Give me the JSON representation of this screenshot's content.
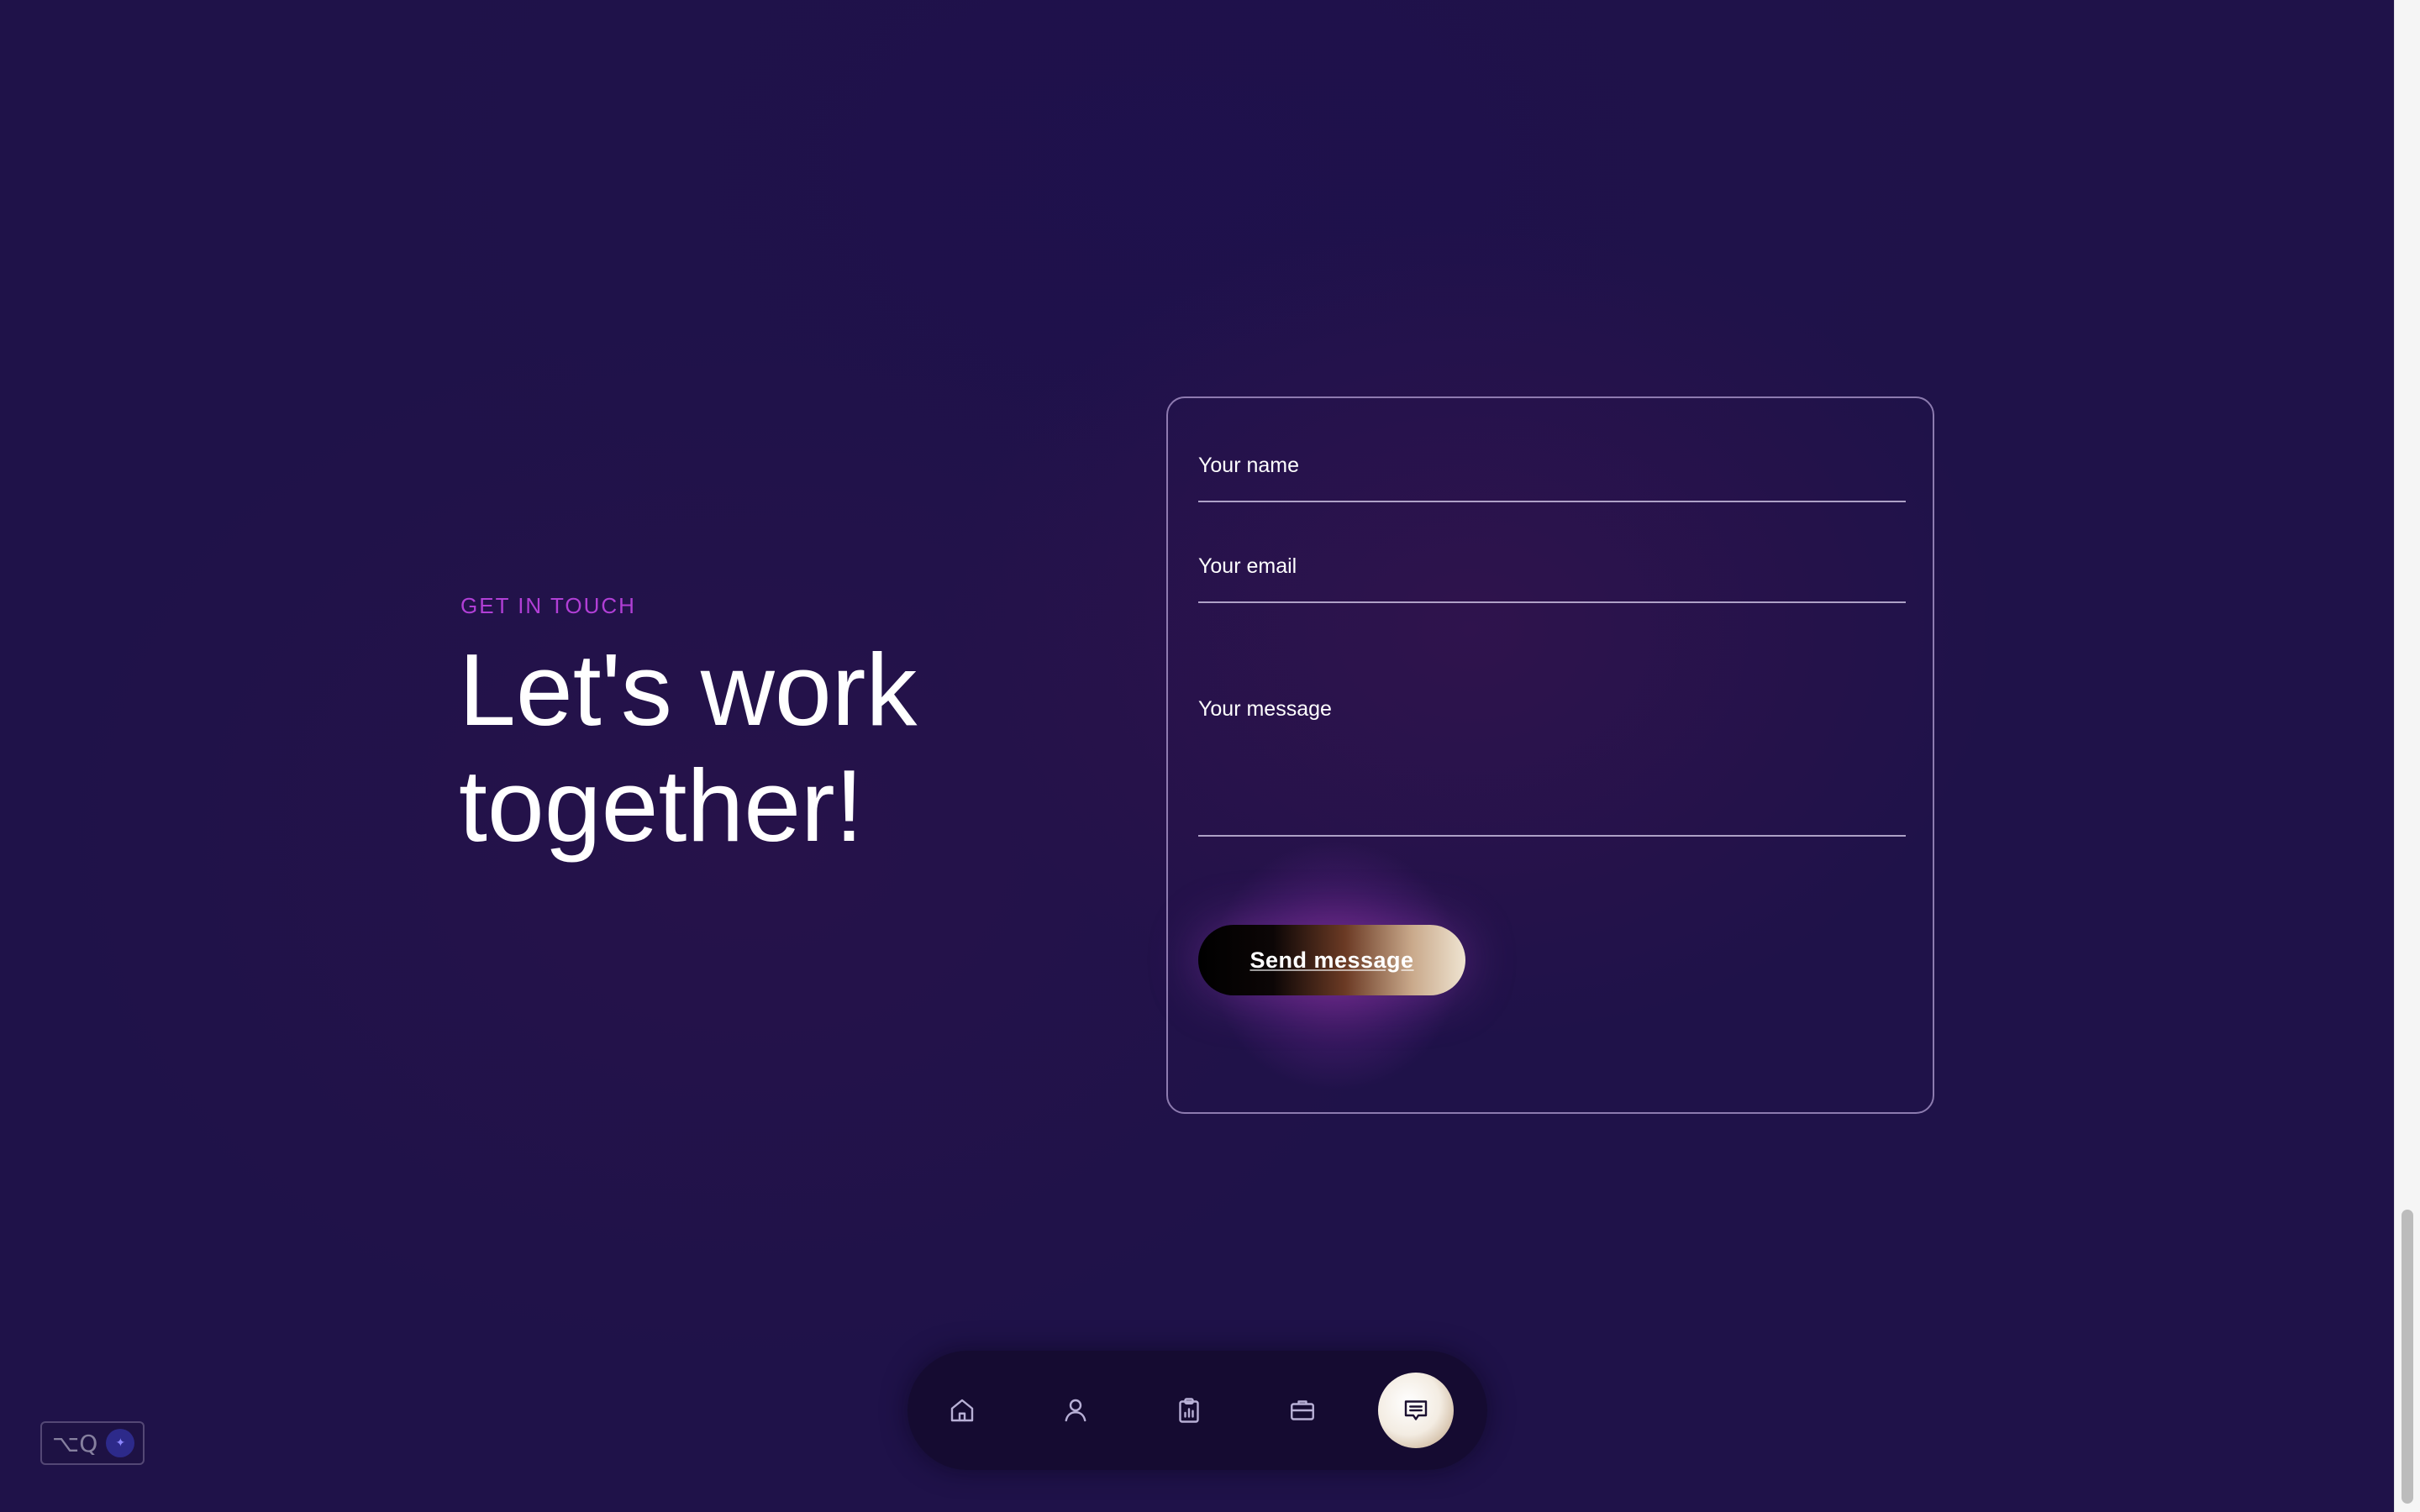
{
  "contact": {
    "eyebrow": "GET IN TOUCH",
    "headline": "Let's work together!"
  },
  "form": {
    "name_placeholder": "Your name",
    "email_placeholder": "Your email",
    "message_placeholder": "Your message",
    "submit_label": "Send message"
  },
  "bottom_nav": {
    "items": [
      {
        "icon": "home-icon",
        "active": false
      },
      {
        "icon": "user-icon",
        "active": false
      },
      {
        "icon": "clipboard-chart-icon",
        "active": false
      },
      {
        "icon": "briefcase-icon",
        "active": false
      },
      {
        "icon": "message-icon",
        "active": true
      }
    ]
  },
  "shortcut_widget": {
    "text": "⌥Q",
    "icon": "sparkle-icon"
  },
  "colors": {
    "background": "#1f1249",
    "accent": "#b13fd6"
  }
}
